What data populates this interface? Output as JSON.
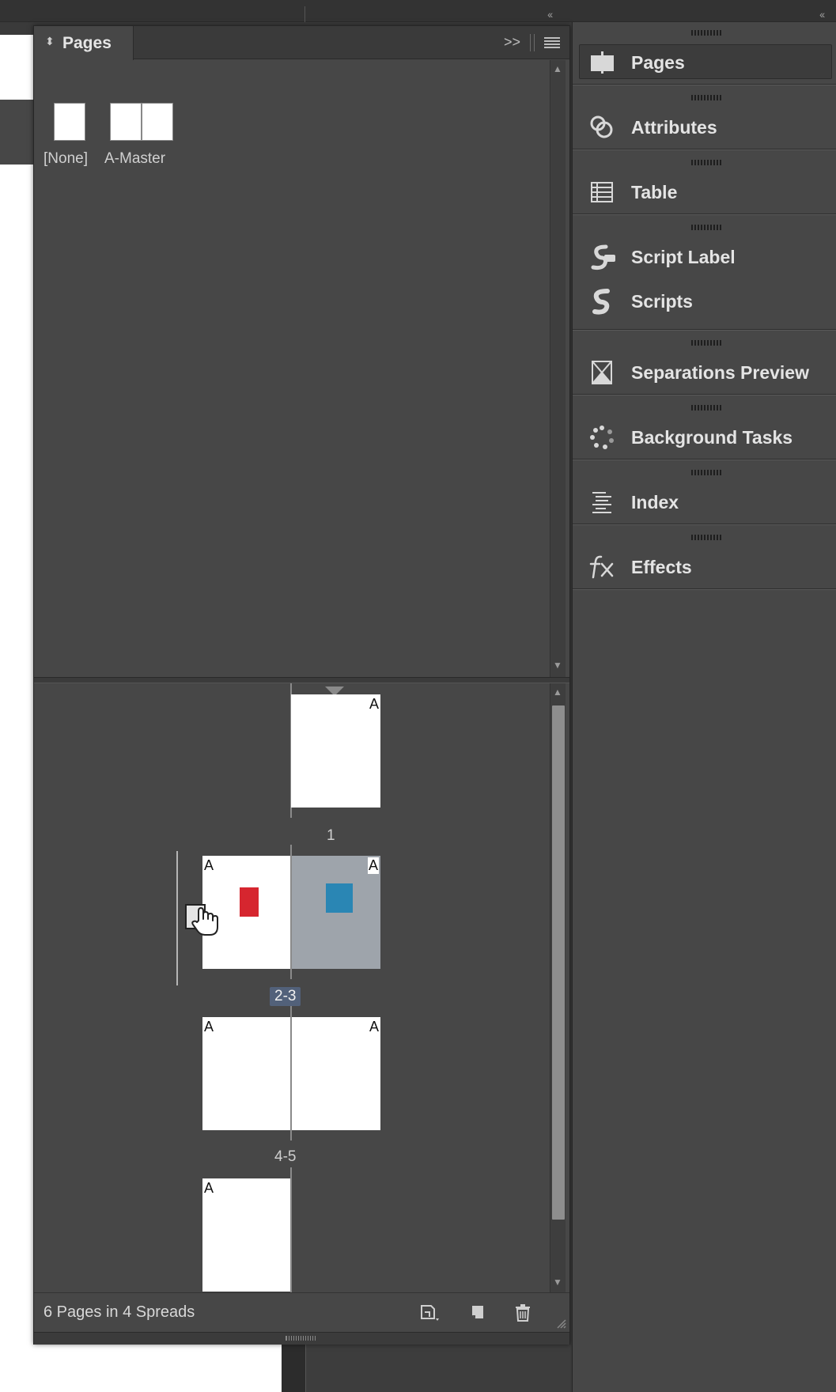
{
  "pages_panel": {
    "title": "Pages",
    "masters": [
      {
        "label": "[None]"
      },
      {
        "label": "A-Master"
      }
    ],
    "spreads": [
      {
        "number_label": "1",
        "prefixes": [
          "A"
        ]
      },
      {
        "number_label": "2-3",
        "prefixes": [
          "A",
          "A"
        ],
        "selected": true
      },
      {
        "number_label": "4-5",
        "prefixes": [
          "A",
          "A"
        ]
      },
      {
        "number_label": "",
        "prefixes": [
          "A"
        ]
      }
    ],
    "status": "6 Pages in 4 Spreads",
    "colors": {
      "red_object": "#d6262f",
      "blue_object": "#2a86b4",
      "selected_page": "#9ea4ab",
      "selected_label_bg": "#52617a"
    }
  },
  "dock": {
    "items": [
      {
        "label": "Pages",
        "icon": "pages-icon",
        "active": true
      },
      {
        "label": "Attributes",
        "icon": "attributes-icon"
      },
      {
        "label": "Table",
        "icon": "table-icon"
      },
      {
        "label": "Script Label",
        "icon": "script-label-icon"
      },
      {
        "label": "Scripts",
        "icon": "scripts-icon"
      },
      {
        "label": "Separations Preview",
        "icon": "separations-icon"
      },
      {
        "label": "Background Tasks",
        "icon": "background-tasks-icon"
      },
      {
        "label": "Index",
        "icon": "index-icon"
      },
      {
        "label": "Effects",
        "icon": "effects-icon"
      }
    ]
  }
}
